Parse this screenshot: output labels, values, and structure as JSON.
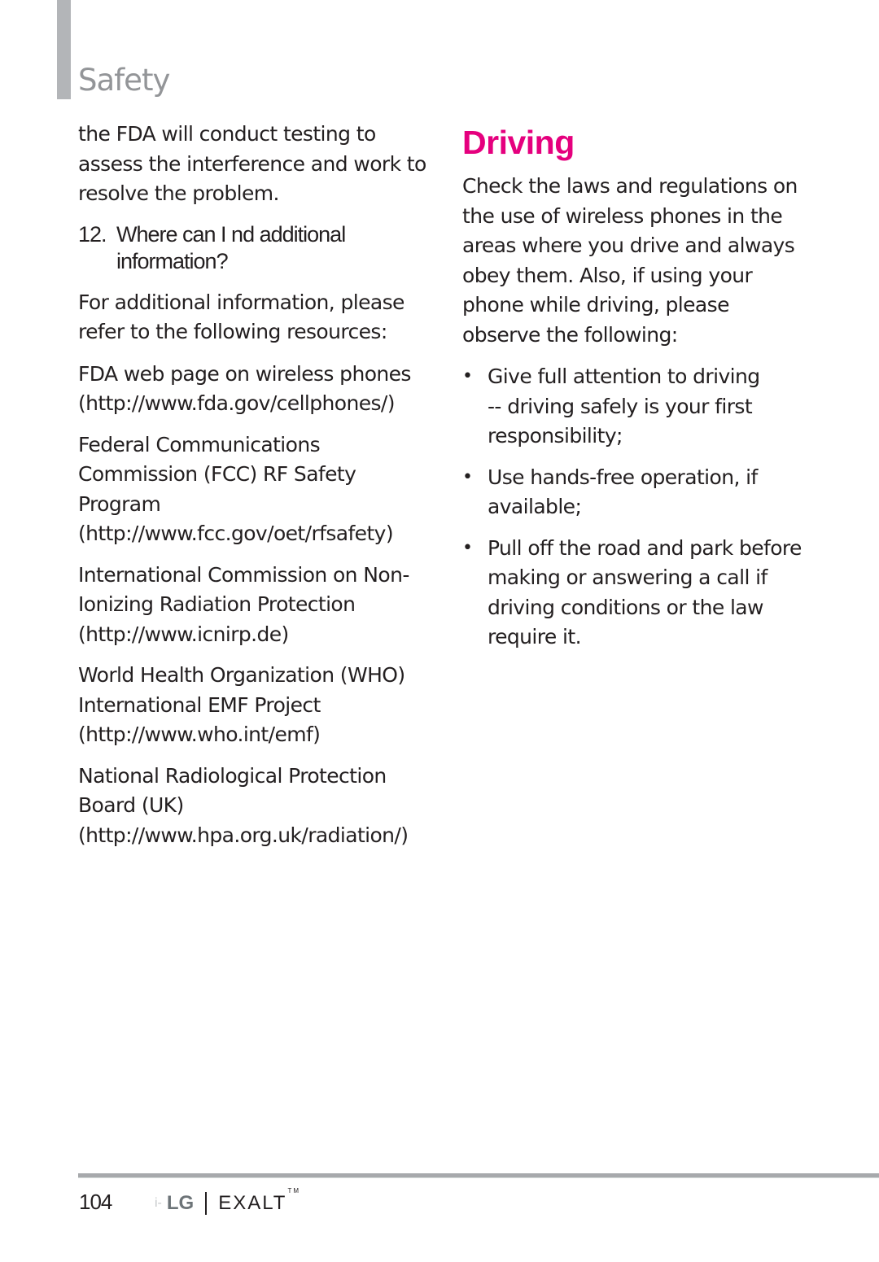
{
  "header": {
    "section_title": "Safety"
  },
  "left_column": {
    "intro_paragraph": "the FDA will conduct testing to assess the interference and work to resolve the problem.",
    "question": {
      "number": "12.",
      "text": "Where can I   nd additional information?"
    },
    "lead_paragraph": "For additional information, please refer to the following resources:",
    "resources": [
      {
        "name": "FDA web page on wireless phones",
        "url": "(http://www.fda.gov/cellphones/)"
      },
      {
        "name": "Federal Communications Commission (FCC) RF Safety Program",
        "url": "(http://www.fcc.gov/oet/rfsafety)"
      },
      {
        "name": "International Commission on Non-Ionizing Radiation Protection",
        "url": "(http://www.icnirp.de)"
      },
      {
        "name": "World Health Organization (WHO) International EMF Project",
        "url": "(http://www.who.int/emf)"
      },
      {
        "name": "National Radiological Protection Board (UK)",
        "url": "(http://www.hpa.org.uk/radiation/)"
      }
    ]
  },
  "right_column": {
    "title": "Driving",
    "title_color": "#e5007e",
    "intro_paragraph": "Check the laws and regulations on the use of wireless phones in the areas where you drive and always obey them. Also, if using your phone while driving, please observe the following:",
    "bullets": [
      "Give full attention to driving -- driving safely is your first responsibility;",
      "Use hands-free operation, if available;",
      "Pull off the road and park before making or answering a call if driving conditions or the law require it."
    ],
    "bullet_glyph": "•"
  },
  "footer": {
    "page_number": "104",
    "brand_mark": "i-",
    "brand_logo": "LG",
    "model_name": "EXALT",
    "trademark": "TM"
  }
}
